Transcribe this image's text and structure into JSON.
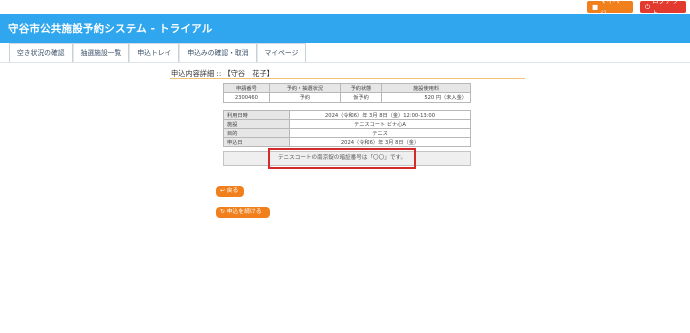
{
  "topbar": {
    "mypage_label": "マイページ",
    "mypage_icon": "user-icon",
    "logout_label": "ログアウト",
    "logout_icon": "power-icon"
  },
  "header": {
    "title": "守谷市公共施設予約システム - トライアル"
  },
  "nav": {
    "items": [
      "空き状況の確認",
      "抽選施設一覧",
      "申込トレイ",
      "申込みの確認・取消",
      "マイページ"
    ]
  },
  "section": {
    "title": "申込内容詳細 :: 【守谷　花子】"
  },
  "summary_table": {
    "headers": [
      "申請番号",
      "予約・抽選状況",
      "予約状態",
      "施設使用料"
    ],
    "row": [
      "2300460",
      "予約",
      "仮予約",
      "520 円（未入金）"
    ]
  },
  "detail_table": {
    "rows": [
      {
        "label": "利用日時",
        "value": "2024（令和6）年 3月 8日（金）12:00-13:00"
      },
      {
        "label": "施設",
        "value": "テニスコート ビナ心A"
      },
      {
        "label": "目的",
        "value": "テニス"
      },
      {
        "label": "申込日",
        "value": "2024（令和6）年 3月 8日（金）"
      }
    ]
  },
  "notice": {
    "text": "テニスコートの南京錠の暗証番号は「〇〇」です。"
  },
  "buttons": {
    "back_label": "戻る",
    "back_icon": "return-icon",
    "continue_label": "申込を続ける",
    "continue_icon": "refresh-icon"
  },
  "colors": {
    "header": "#2fa6ee",
    "accent": "#f07f1c",
    "logout": "#e23a2e",
    "highlight": "#d32b2b"
  }
}
